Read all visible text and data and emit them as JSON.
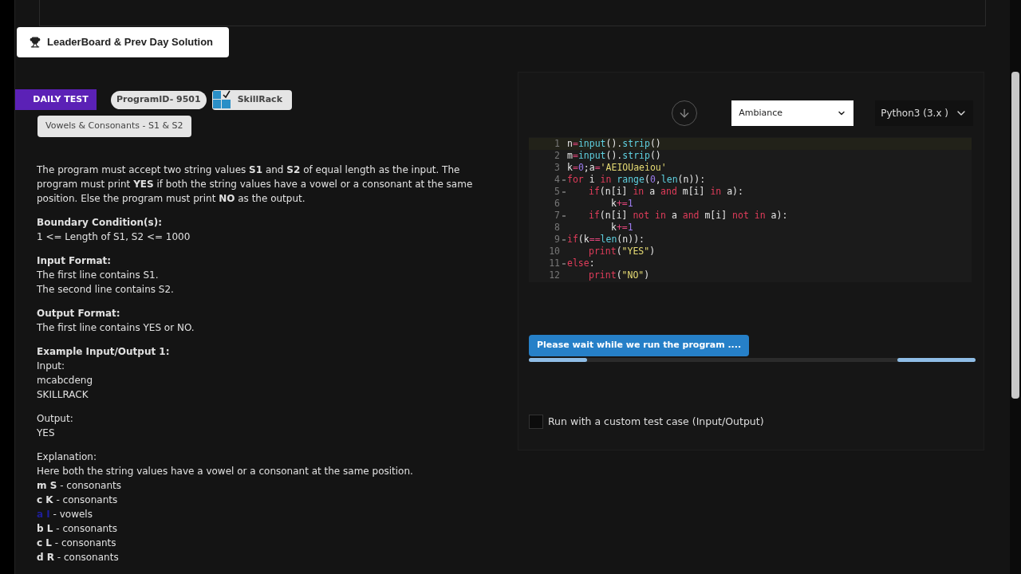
{
  "leaderboard_button": {
    "label": "LeaderBoard & Prev Day Solution"
  },
  "ribbon": {
    "label": "DAILY TEST"
  },
  "program_id": {
    "label": "ProgramID- 9501"
  },
  "brand": {
    "label": "SkillRack"
  },
  "problem_title": {
    "label": "Vowels & Consonants - S1 & S2"
  },
  "description": "The program must accept two string values **S1** and **S2** of equal length as the input. The program must print **YES** if both the string values have a vowel or a consonant at the same position. Else the program must print **NO** as the output.",
  "sections": [
    {
      "heading": "Boundary Condition(s):",
      "lines": [
        "1 <= Length of S1, S2 <= 1000"
      ]
    },
    {
      "heading": "Input Format:",
      "lines": [
        "The first line contains S1.",
        "The second line contains S2."
      ]
    },
    {
      "heading": "Output Format:",
      "lines": [
        "The first line contains YES or NO."
      ]
    },
    {
      "heading": "Example Input/Output 1:",
      "lines": [
        "Input:",
        "mcabcdeng",
        "SKILLRACK"
      ]
    },
    {
      "lines": [
        "Output:",
        "YES"
      ]
    }
  ],
  "explanation": {
    "title": "Explanation:",
    "intro": "Here both the string values have a vowel or a consonant at the same position.",
    "pairs": [
      {
        "pair": "m S",
        "text": " - consonants",
        "highlighted": false
      },
      {
        "pair": "c K",
        "text": " - consonants",
        "highlighted": false
      },
      {
        "pair": "a I",
        "text": " - vowels",
        "highlighted": true
      },
      {
        "pair": "b L",
        "text": " - consonants",
        "highlighted": false
      },
      {
        "pair": "c L",
        "text": " - consonants",
        "highlighted": false
      },
      {
        "pair": "d R",
        "text": " - consonants",
        "highlighted": false
      }
    ]
  },
  "theme_select": {
    "value": "Ambiance"
  },
  "language_select": {
    "value": "Python3 (3.x )"
  },
  "code": [
    {
      "number": "1",
      "foldable": false,
      "tokens": [
        {
          "kind": "plain",
          "text": "n"
        },
        {
          "kind": "op",
          "text": "="
        },
        {
          "kind": "fn",
          "text": "input"
        },
        {
          "kind": "plain",
          "text": "()."
        },
        {
          "kind": "fn",
          "text": "strip"
        },
        {
          "kind": "plain",
          "text": "()"
        }
      ]
    },
    {
      "number": "2",
      "foldable": false,
      "tokens": [
        {
          "kind": "plain",
          "text": "m"
        },
        {
          "kind": "op",
          "text": "="
        },
        {
          "kind": "fn",
          "text": "input"
        },
        {
          "kind": "plain",
          "text": "()."
        },
        {
          "kind": "fn",
          "text": "strip"
        },
        {
          "kind": "plain",
          "text": "()"
        }
      ]
    },
    {
      "number": "3",
      "foldable": false,
      "tokens": [
        {
          "kind": "plain",
          "text": "k"
        },
        {
          "kind": "op",
          "text": "="
        },
        {
          "kind": "num",
          "text": "0"
        },
        {
          "kind": "plain",
          "text": ";a"
        },
        {
          "kind": "op",
          "text": "="
        },
        {
          "kind": "str",
          "text": "'AEIOUaeiou'"
        }
      ]
    },
    {
      "number": "4",
      "foldable": true,
      "tokens": [
        {
          "kind": "kw",
          "text": "for"
        },
        {
          "kind": "plain",
          "text": " i "
        },
        {
          "kind": "kw",
          "text": "in"
        },
        {
          "kind": "fn",
          "text": " range"
        },
        {
          "kind": "plain",
          "text": "("
        },
        {
          "kind": "num",
          "text": "0"
        },
        {
          "kind": "plain",
          "text": ","
        },
        {
          "kind": "fn",
          "text": "len"
        },
        {
          "kind": "plain",
          "text": "(n)):"
        }
      ],
      "children": [
        {
          "number": "5",
          "foldable": true,
          "tokens": [
            {
              "kind": "kw",
              "text": "if"
            },
            {
              "kind": "plain",
              "text": "(n[i] "
            },
            {
              "kind": "kw",
              "text": "in"
            },
            {
              "kind": "plain",
              "text": " a "
            },
            {
              "kind": "kw",
              "text": "and"
            },
            {
              "kind": "plain",
              "text": " m[i] "
            },
            {
              "kind": "kw",
              "text": "in"
            },
            {
              "kind": "plain",
              "text": " a):"
            }
          ],
          "children": [
            {
              "number": "6",
              "foldable": false,
              "tokens": [
                {
                  "kind": "plain",
                  "text": "k"
                },
                {
                  "kind": "op",
                  "text": "+="
                },
                {
                  "kind": "num",
                  "text": "1"
                }
              ]
            }
          ]
        },
        {
          "number": "7",
          "foldable": true,
          "tokens": [
            {
              "kind": "kw",
              "text": "if"
            },
            {
              "kind": "plain",
              "text": "(n[i] "
            },
            {
              "kind": "kw",
              "text": "not in"
            },
            {
              "kind": "plain",
              "text": " a "
            },
            {
              "kind": "kw",
              "text": "and"
            },
            {
              "kind": "plain",
              "text": " m[i] "
            },
            {
              "kind": "kw",
              "text": "not in"
            },
            {
              "kind": "plain",
              "text": " a):"
            }
          ],
          "children": [
            {
              "number": "8",
              "foldable": false,
              "tokens": [
                {
                  "kind": "plain",
                  "text": "k"
                },
                {
                  "kind": "op",
                  "text": "+="
                },
                {
                  "kind": "num",
                  "text": "1"
                }
              ]
            }
          ]
        }
      ]
    },
    {
      "number": "9",
      "foldable": true,
      "tokens": [
        {
          "kind": "kw",
          "text": "if"
        },
        {
          "kind": "plain",
          "text": "(k"
        },
        {
          "kind": "op",
          "text": "=="
        },
        {
          "kind": "fn",
          "text": "len"
        },
        {
          "kind": "plain",
          "text": "(n)):"
        }
      ],
      "children": [
        {
          "number": "10",
          "foldable": false,
          "tokens": [
            {
              "kind": "kw",
              "text": "print"
            },
            {
              "kind": "plain",
              "text": "("
            },
            {
              "kind": "str",
              "text": "\"YES\""
            },
            {
              "kind": "plain",
              "text": ")"
            }
          ]
        }
      ]
    },
    {
      "number": "11",
      "foldable": true,
      "tokens": [
        {
          "kind": "kw",
          "text": "else"
        },
        {
          "kind": "plain",
          "text": ":"
        }
      ],
      "children": [
        {
          "number": "12",
          "foldable": false,
          "tokens": [
            {
              "kind": "kw",
              "text": "print"
            },
            {
              "kind": "plain",
              "text": "("
            },
            {
              "kind": "str",
              "text": "\"NO\""
            },
            {
              "kind": "plain",
              "text": ")"
            }
          ]
        }
      ]
    }
  ],
  "run_status": {
    "label": "Please wait while we run the program ...."
  },
  "progress": {
    "level": 0.13
  },
  "custom_test": {
    "label": "Run with a custom test case (Input/Output)",
    "checked": false
  }
}
